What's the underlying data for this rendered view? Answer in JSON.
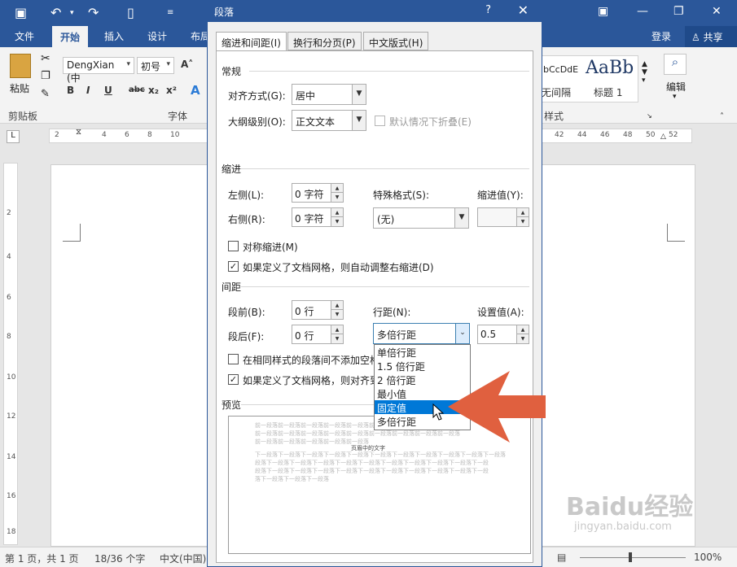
{
  "word": {
    "tabs": [
      "文件",
      "开始",
      "插入",
      "设计",
      "布局"
    ],
    "active_tab": "开始",
    "login": "登录",
    "share": "共享",
    "font_name": "DengXian (中",
    "font_size": "初号",
    "groups": {
      "clipboard": "剪贴板",
      "font": "字体",
      "styles": "样式",
      "editing": "编辑"
    },
    "paste_label": "粘贴",
    "styles": [
      {
        "sample": "bCcDdE",
        "name": "无间隔"
      },
      {
        "sample": "AaBb",
        "name": "标题 1"
      }
    ],
    "ruler_left": [
      "2",
      "2",
      "4",
      "6",
      "8",
      "10"
    ],
    "ruler_right": [
      "42",
      "44",
      "46",
      "48",
      "50",
      "52"
    ],
    "vruler": [
      "2",
      "4",
      "6",
      "8",
      "10",
      "12",
      "14",
      "16",
      "18"
    ],
    "status": {
      "page": "第 1 页，共 1 页",
      "words": "18/36 个字",
      "lang": "中文(中国)",
      "zoom": "100%"
    },
    "watermark": "Baidu经验",
    "watermark_url": "jingyan.baidu.com"
  },
  "dialog": {
    "title": "段落",
    "help": "?",
    "close": "✕",
    "tabs": [
      "缩进和间距(I)",
      "换行和分页(P)",
      "中文版式(H)"
    ],
    "general": {
      "section": "常规",
      "align_label": "对齐方式(G):",
      "align_value": "居中",
      "outline_label": "大纲级别(O):",
      "outline_value": "正文文本",
      "collapse_label": "默认情况下折叠(E)"
    },
    "indent": {
      "section": "缩进",
      "left_label": "左侧(L):",
      "left_value": "0 字符",
      "right_label": "右侧(R):",
      "right_value": "0 字符",
      "special_label": "特殊格式(S):",
      "special_value": "(无)",
      "by_label": "缩进值(Y):",
      "mirror_label": "对称缩进(M)",
      "grid_label": "如果定义了文档网格，则自动调整右缩进(D)"
    },
    "spacing": {
      "section": "间距",
      "before_label": "段前(B):",
      "before_value": "0 行",
      "after_label": "段后(F):",
      "after_value": "0 行",
      "line_label": "行距(N):",
      "line_value": "多倍行距",
      "at_label": "设置值(A):",
      "at_value": "0.5",
      "nospace_label": "在相同样式的段落间不添加空格",
      "snap_label": "如果定义了文档网格，则对齐到"
    },
    "line_options": [
      "单倍行距",
      "1.5 倍行距",
      "2 倍行距",
      "最小值",
      "固定值",
      "多倍行距"
    ],
    "highlighted_option": "固定值",
    "preview": {
      "section": "预览",
      "prev_lines": [
        "前一段落前一段落前一段落前一段落前一段落前一段落前一段落前一段落前一段落",
        "前一段落前一段落前一段落前一段落前一段落前一段落前一段落前一段落前一段落",
        "前一段落前一段落前一段落前一段落前一段落"
      ],
      "sample": "页眉中的文字",
      "next_lines": [
        "下一段落下一段落下一段落下一段落下一段落下一段落下一段落下一段落下一段落下一段落下一段落",
        "段落下一段落下一段落下一段落下一段落下一段落下一段落下一段落下一段落下一段落下一段",
        "段落下一段落下一段落下一段落下一段落下一段落下一段落下一段落下一段落下一段落下一段",
        "落下一段落下一段落下一段落"
      ]
    }
  },
  "colors": {
    "word_blue": "#2b579a",
    "arrow": "#e0603f",
    "highlight": "#0078d7"
  }
}
